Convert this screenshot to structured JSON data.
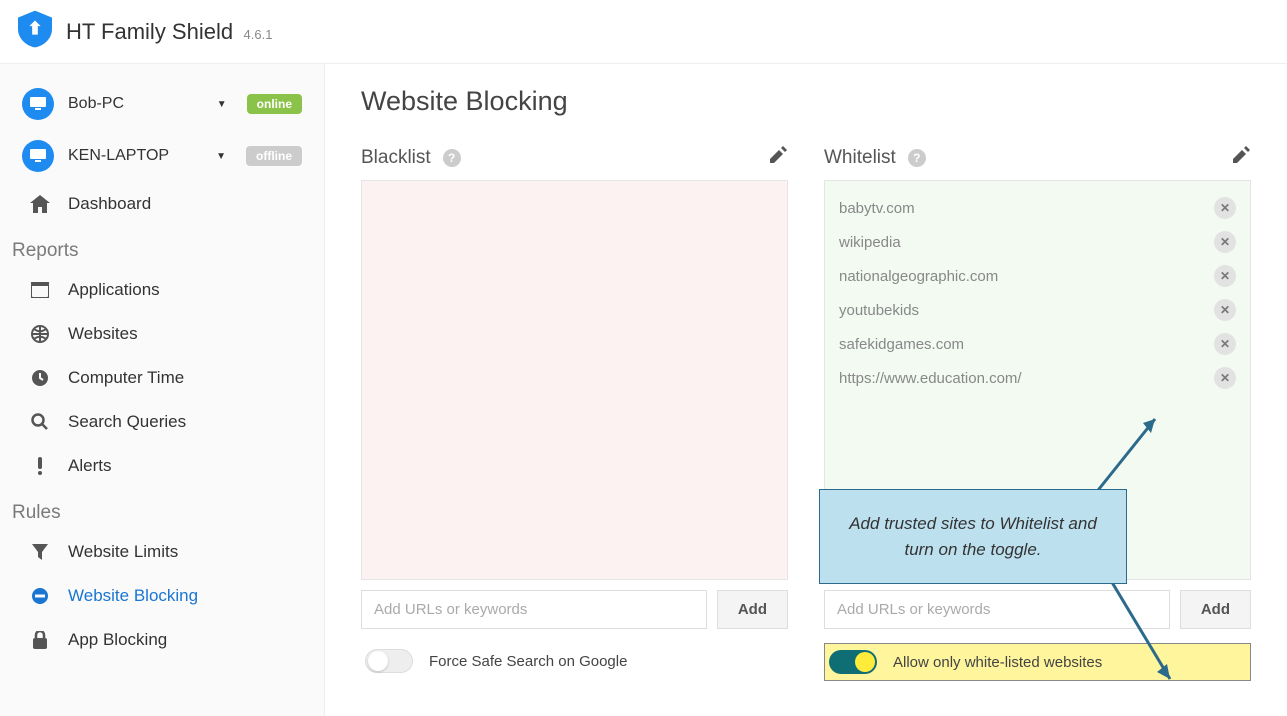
{
  "app": {
    "title": "HT Family Shield",
    "version": "4.6.1"
  },
  "devices": [
    {
      "name": "Bob-PC",
      "status": "online"
    },
    {
      "name": "KEN-LAPTOP",
      "status": "offline"
    }
  ],
  "nav_dashboard": "Dashboard",
  "section_reports": "Reports",
  "nav_reports": [
    "Applications",
    "Websites",
    "Computer Time",
    "Search Queries",
    "Alerts"
  ],
  "section_rules": "Rules",
  "nav_rules": [
    "Website Limits",
    "Website Blocking",
    "App Blocking"
  ],
  "page_title": "Website Blocking",
  "blacklist": {
    "title": "Blacklist",
    "items": [],
    "placeholder": "Add URLs or keywords",
    "add_label": "Add",
    "toggle_label": "Force Safe Search on Google"
  },
  "whitelist": {
    "title": "Whitelist",
    "items": [
      "babytv.com",
      "wikipedia",
      "nationalgeographic.com",
      "youtubekids",
      "safekidgames.com",
      "https://www.education.com/"
    ],
    "placeholder": "Add URLs or keywords",
    "add_label": "Add",
    "toggle_label": "Allow only white-listed websites"
  },
  "callout_text": "Add trusted sites to Whitelist and turn on the toggle."
}
